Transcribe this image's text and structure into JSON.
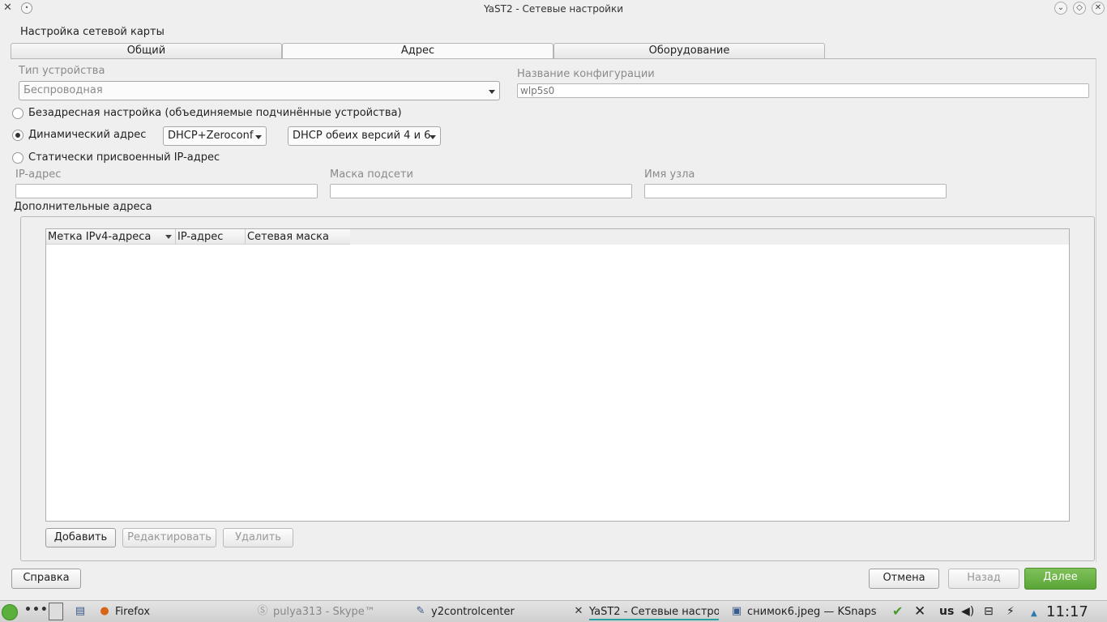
{
  "window": {
    "title": "YaST2 - Сетевые настройки",
    "app_icon": "yast-icon",
    "menu_icon": "window-menu-icon",
    "controls": [
      "minimize-icon",
      "maximize-icon",
      "close-icon"
    ]
  },
  "section_title": "Настройка сетевой карты",
  "tabs": [
    {
      "label": "Общий",
      "active": false
    },
    {
      "label": "Адрес",
      "active": true
    },
    {
      "label": "Оборудование",
      "active": false
    }
  ],
  "device_type": {
    "label": "Тип устройства",
    "value": "Беспроводная"
  },
  "config_name": {
    "label": "Название конфигурации",
    "value": "wlp5s0"
  },
  "address_options": {
    "none": "Безадресная настройка (объединяемые подчинённые устройства)",
    "dynamic": "Динамический адрес",
    "static": "Статически присвоенный IP-адрес",
    "selected": "dynamic",
    "dhcp_mode": "DHCP+Zeroconf",
    "dhcp_version": "DHCP обеих версий 4 и 6"
  },
  "static_fields": {
    "ip_label": "IP-адрес",
    "ip_value": "",
    "mask_label": "Маска подсети",
    "mask_value": "",
    "hostname_label": "Имя узла",
    "hostname_value": ""
  },
  "additional": {
    "title": "Дополнительные адреса",
    "columns": [
      "Метка IPv4-адреса",
      "IP-адрес",
      "Сетевая маска"
    ],
    "rows": [],
    "add_label": "Добавить",
    "edit_label": "Редактировать",
    "delete_label": "Удалить"
  },
  "footer": {
    "help_label": "Справка",
    "cancel_label": "Отмена",
    "back_label": "Назад",
    "next_label": "Далее"
  },
  "taskbar": {
    "items": [
      {
        "icon": "firefox-icon",
        "label": "Firefox"
      },
      {
        "icon": "skype-icon",
        "label": "pulya313 - Skype™"
      },
      {
        "icon": "yast-control-icon",
        "label": "y2controlcenter"
      },
      {
        "icon": "yast-icon",
        "label": "YaST2 - Сетевые настро"
      },
      {
        "icon": "image-icon",
        "label": "снимок6.jpeg — KSnapsh"
      }
    ],
    "keyboard_layout": "us",
    "clock": "11:17"
  },
  "colors": {
    "accent_green": "#5aa537",
    "active_task_underline": "#2ba0a0"
  }
}
